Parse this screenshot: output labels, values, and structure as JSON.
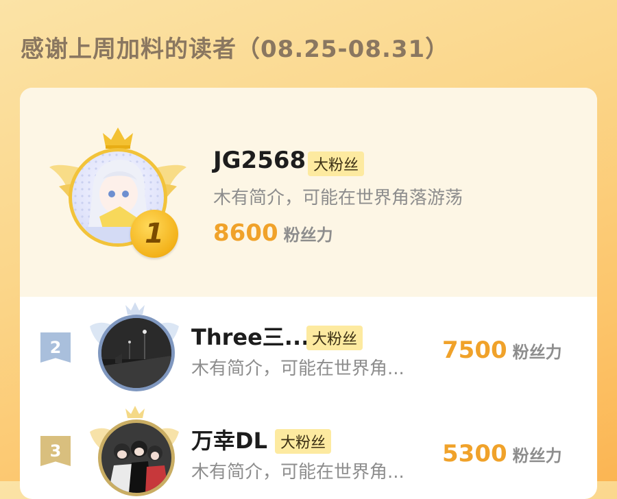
{
  "page": {
    "title": "感谢上周加料的读者（08.25-08.31）"
  },
  "colors": {
    "accent_orange": "#f0a22a",
    "badge_bg": "#fdeaa0",
    "silver": "#a9bfdc",
    "bronze": "#d9bf7e",
    "gold": "#f3b21a"
  },
  "first": {
    "rank": "1",
    "name": "JG2568",
    "badge": "大粉丝",
    "bio": "木有简介，可能在世界角落游荡",
    "score": "8600",
    "unit": "粉丝力"
  },
  "others": [
    {
      "rank": "2",
      "name": "Three三...",
      "badge": "大粉丝",
      "bio": "木有简介，可能在世界角...",
      "score": "7500",
      "unit": "粉丝力"
    },
    {
      "rank": "3",
      "name": "万幸DL",
      "badge": "大粉丝",
      "bio": "木有简介，可能在世界角...",
      "score": "5300",
      "unit": "粉丝力"
    }
  ]
}
